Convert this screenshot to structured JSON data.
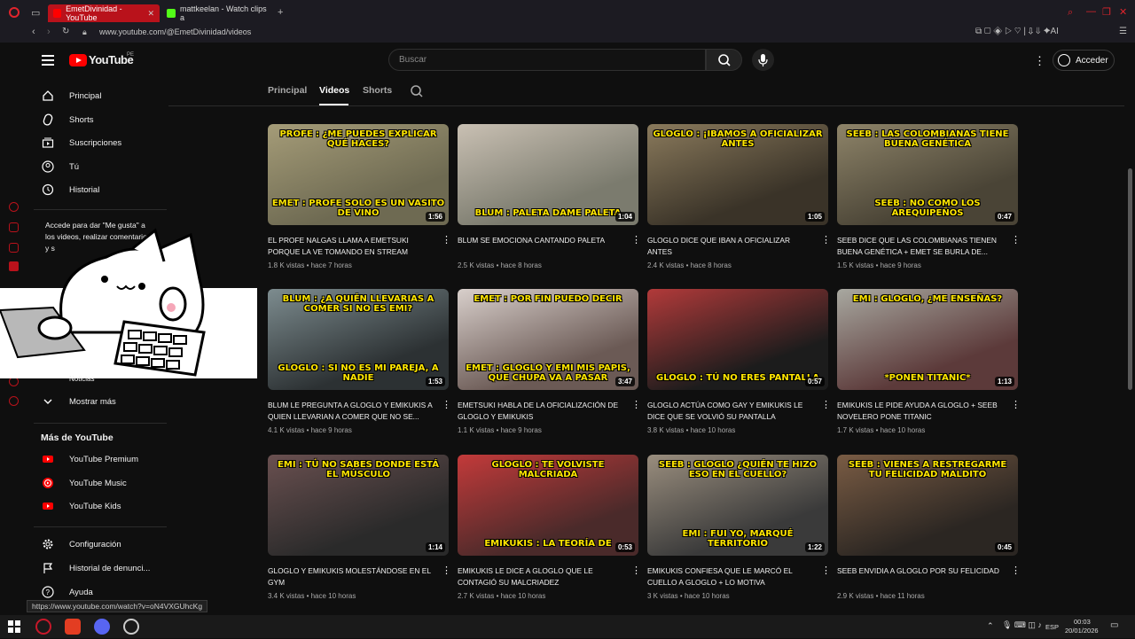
{
  "browser": {
    "tabs": [
      {
        "label": "EmetDivinidad - YouTube",
        "active": true
      },
      {
        "label": "mattkeelan - Watch clips a",
        "active": false
      }
    ],
    "new_tab": "+",
    "url": "www.youtube.com/@EmetDivinidad/videos",
    "status_url": "https://www.youtube.com/watch?v=oN4VXGUhcKg"
  },
  "header": {
    "logo_text": "YouTube",
    "region": "PE",
    "search_placeholder": "Buscar",
    "signin_label": "Acceder"
  },
  "sidebar": {
    "items": [
      {
        "label": "Principal",
        "icon": "home-icon"
      },
      {
        "label": "Shorts",
        "icon": "shorts-icon"
      },
      {
        "label": "Suscripciones",
        "icon": "subscriptions-icon"
      },
      {
        "label": "Tú",
        "icon": "user-icon"
      },
      {
        "label": "Historial",
        "icon": "history-icon"
      }
    ],
    "signin_message": "Accede para dar \"Me gusta\" a los videos, realizar comentarios y s",
    "explore_partial": "Noticias",
    "show_more": "Mostrar más",
    "more_heading": "Más de YouTube",
    "more_items": [
      {
        "label": "YouTube Premium"
      },
      {
        "label": "YouTube Music"
      },
      {
        "label": "YouTube Kids"
      }
    ],
    "bottom_items": [
      {
        "label": "Configuración",
        "icon": "gear-icon"
      },
      {
        "label": "Historial de denunci...",
        "icon": "flag-icon"
      },
      {
        "label": "Ayuda",
        "icon": "help-icon"
      }
    ]
  },
  "channel_tabs": [
    {
      "label": "Principal",
      "active": false
    },
    {
      "label": "Videos",
      "active": true
    },
    {
      "label": "Shorts",
      "active": false
    }
  ],
  "videos": [
    {
      "title": "EL PROFE NALGAS LLAMA A EMETSUKI PORQUE LA VE TOMANDO EN STREAM",
      "views": "1.8 K vistas",
      "age": "hace 7 horas",
      "duration": "1:56",
      "cap_top": "PROFE : ¿ME PUEDES EXPLICAR QUÉ HACES?",
      "cap_bottom": "EMET : PROFE SOLO ES UN VASITO DE VINO"
    },
    {
      "title": "BLUM SE EMOCIONA CANTANDO PALETA",
      "views": "2.5 K vistas",
      "age": "hace 8 horas",
      "duration": "1:04",
      "cap_top": "",
      "cap_bottom": "BLUM : PALETA DAME PALETA"
    },
    {
      "title": "GLOGLO DICE QUE IBAN A OFICIALIZAR ANTES",
      "views": "2.4 K vistas",
      "age": "hace 8 horas",
      "duration": "1:05",
      "cap_top": "GLOGLO : ¡IBAMOS A OFICIALIZAR ANTES",
      "cap_bottom": ""
    },
    {
      "title": "SEEB DICE QUE LAS COLOMBIANAS TIENEN BUENA GENÉTICA + EMET SE BURLA DE...",
      "views": "1.5 K vistas",
      "age": "hace 9 horas",
      "duration": "0:47",
      "cap_top": "SEEB : LAS COLOMBIANAS TIENE BUENA GENÉTICA",
      "cap_bottom": "SEEB : NO COMO LOS AREQUIPEÑOS"
    },
    {
      "title": "BLUM LE PREGUNTA A GLOGLO Y EMIKUKIS A QUIEN LLEVARIAN A COMER QUE NO SE...",
      "views": "4.1 K vistas",
      "age": "hace 9 horas",
      "duration": "1:53",
      "cap_top": "BLUM : ¿A QUIÉN LLEVARIAS A COMER SI NO ES EMI?",
      "cap_bottom": "GLOGLO : SI NO ES MI PAREJA, A NADIE"
    },
    {
      "title": "EMETSUKI HABLA DE LA OFICIALIZACIÓN DE GLOGLO Y EMIKUKIS",
      "views": "1.1 K vistas",
      "age": "hace 9 horas",
      "duration": "3:47",
      "cap_top": "EMET : POR FIN PUEDO DECIR",
      "cap_bottom": "EMET : GLOGLO Y EMI MIS PAPIS, QUE CHUPA VA A PASAR"
    },
    {
      "title": "GLOGLO ACTÚA COMO GAY Y EMIKUKIS LE DICE QUE SE VOLVIÓ SU PANTALLA",
      "views": "3.8 K vistas",
      "age": "hace 10 horas",
      "duration": "0:57",
      "cap_top": "",
      "cap_bottom": "GLOGLO : TÚ NO ERES PANTALLA"
    },
    {
      "title": "EMIKUKIS LE PIDE AYUDA A GLOGLO + SEEB NOVELERO PONE TITANIC",
      "views": "1.7 K vistas",
      "age": "hace 10 horas",
      "duration": "1:13",
      "cap_top": "EMI : GLOGLO, ¿ME ENSEÑAS?",
      "cap_bottom": "*PONEN TITANIC*"
    },
    {
      "title": "GLOGLO Y EMIKUKIS MOLESTÁNDOSE EN EL GYM",
      "views": "3.4 K vistas",
      "age": "hace 10 horas",
      "duration": "1:14",
      "cap_top": "EMI : TÚ NO SABES DONDE ESTÁ EL MÚSCULO",
      "cap_bottom": ""
    },
    {
      "title": "EMIKUKIS LE DICE A GLOGLO QUE LE CONTAGIÓ SU MALCRIADEZ",
      "views": "2.7 K vistas",
      "age": "hace 10 horas",
      "duration": "0:53",
      "cap_top": "GLOGLO : TE VOLVISTE MALCRIADA",
      "cap_bottom": "EMIKUKIS : LA TEORÍA DE"
    },
    {
      "title": "EMIKUKIS CONFIESA QUE LE MARCÓ EL CUELLO A GLOGLO + LO MOTIVA",
      "views": "3 K vistas",
      "age": "hace 10 horas",
      "duration": "1:22",
      "cap_top": "SEEB : GLOGLO ¿QUIÉN TE HIZO ESO EN EL CUELLO?",
      "cap_bottom": "EMI : FUI YO, MARQUÉ TERRITORIO"
    },
    {
      "title": "SEEB ENVIDIA A GLOGLO POR SU FELICIDAD",
      "views": "2.9 K vistas",
      "age": "hace 11 horas",
      "duration": "0:45",
      "cap_top": "SEEB : VIENES A RESTREGARME TU FELICIDAD MALDITO",
      "cap_bottom": ""
    }
  ],
  "taskbar": {
    "language": "ESP",
    "time": "00:03",
    "date": "20/01/2026"
  }
}
